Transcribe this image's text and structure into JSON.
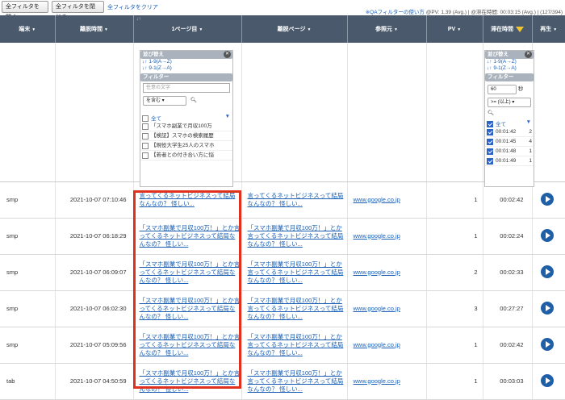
{
  "toolbar": {
    "open_all": "全フィルタを開く",
    "close_all": "全フィルタを閉じる",
    "clear_all": "全フィルタをクリア",
    "stats_link": "※QAフィルターの使い方",
    "stats_text": "@PV: 1.39 (Avg.) | @滞在時間: 00:03:15 (Avg.) | (127/394)"
  },
  "headers": {
    "device": "端末",
    "exit_time": "離脱時間",
    "first_page": "1ページ目",
    "exit_page": "離脱ページ",
    "referrer": "参照元",
    "pv": "PV",
    "stay": "滞在時間",
    "replay": "再生"
  },
  "filter_page": {
    "sort_title": "並び替え",
    "sort_asc": "1-9(A→Z)",
    "sort_desc": "9-1(Z→A)",
    "filter_title": "フィルター",
    "placeholder": "任意の文字",
    "match": "を含む",
    "all": "全て",
    "items": [
      "「スマホ副業で月収100万",
      "【検証】スマホの検索履歴",
      "【現役大学生25人のスマホ",
      "【若者との付き合い方に悩"
    ]
  },
  "filter_stay": {
    "sort_title": "並び替え",
    "sort_asc": "1-9(A→Z)",
    "sort_desc": "9-1(Z→A)",
    "filter_title": "フィルター",
    "value": "60",
    "unit": "秒",
    "op": ">= (以上)",
    "all": "全て",
    "items": [
      {
        "time": "00:01:42",
        "count": "2"
      },
      {
        "time": "00:01:45",
        "count": "4"
      },
      {
        "time": "00:01:48",
        "count": "1"
      },
      {
        "time": "00:01:49",
        "count": "1"
      }
    ]
  },
  "rows": [
    {
      "device": "smp",
      "time": "2021-10-07 07:10:46",
      "first": "言ってくるネットビジネスって結局なんなの？ 怪しい...",
      "exit": "言ってくるネットビジネスって結局なんなの？ 怪しい...",
      "ref": "www.google.co.jp",
      "pv": "1",
      "stay": "00:02:42"
    },
    {
      "device": "smp",
      "time": "2021-10-07 06:18:29",
      "first": "「スマホ副業で月収100万！」とか言ってくるネットビジネスって結局なんなの？ 怪しい...",
      "exit": "「スマホ副業で月収100万！」とか言ってくるネットビジネスって結局なんなの？ 怪しい...",
      "ref": "www.google.co.jp",
      "pv": "1",
      "stay": "00:02:24"
    },
    {
      "device": "smp",
      "time": "2021-10-07 06:09:07",
      "first": "「スマホ副業で月収100万！」とか言ってくるネットビジネスって結局なんなの？ 怪しい...",
      "exit": "「スマホ副業で月収100万！」とか言ってくるネットビジネスって結局なんなの？ 怪しい...",
      "ref": "www.google.co.jp",
      "pv": "2",
      "stay": "00:02:33"
    },
    {
      "device": "smp",
      "time": "2021-10-07 06:02:30",
      "first": "「スマホ副業で月収100万！」とか言ってくるネットビジネスって結局なんなの？ 怪しい...",
      "exit": "「スマホ副業で月収100万！」とか言ってくるネットビジネスって結局なんなの？ 怪しい...",
      "ref": "www.google.co.jp",
      "pv": "3",
      "stay": "00:27:27"
    },
    {
      "device": "smp",
      "time": "2021-10-07 05:09:56",
      "first": "「スマホ副業で月収100万！」とか言ってくるネットビジネスって結局なんなの？ 怪しい...",
      "exit": "「スマホ副業で月収100万！」とか言ってくるネットビジネスって結局なんなの？ 怪しい...",
      "ref": "www.google.co.jp",
      "pv": "1",
      "stay": "00:02:42"
    },
    {
      "device": "tab",
      "time": "2021-10-07 04:50:59",
      "first": "「スマホ副業で月収100万！」とか言ってくるネットビジネスって結局なんなの？ 怪しい...",
      "exit": "「スマホ副業で月収100万！」とか言ってくるネットビジネスって結局なんなの？ 怪しい...",
      "ref": "www.google.co.jp",
      "pv": "1",
      "stay": "00:03:03"
    }
  ]
}
